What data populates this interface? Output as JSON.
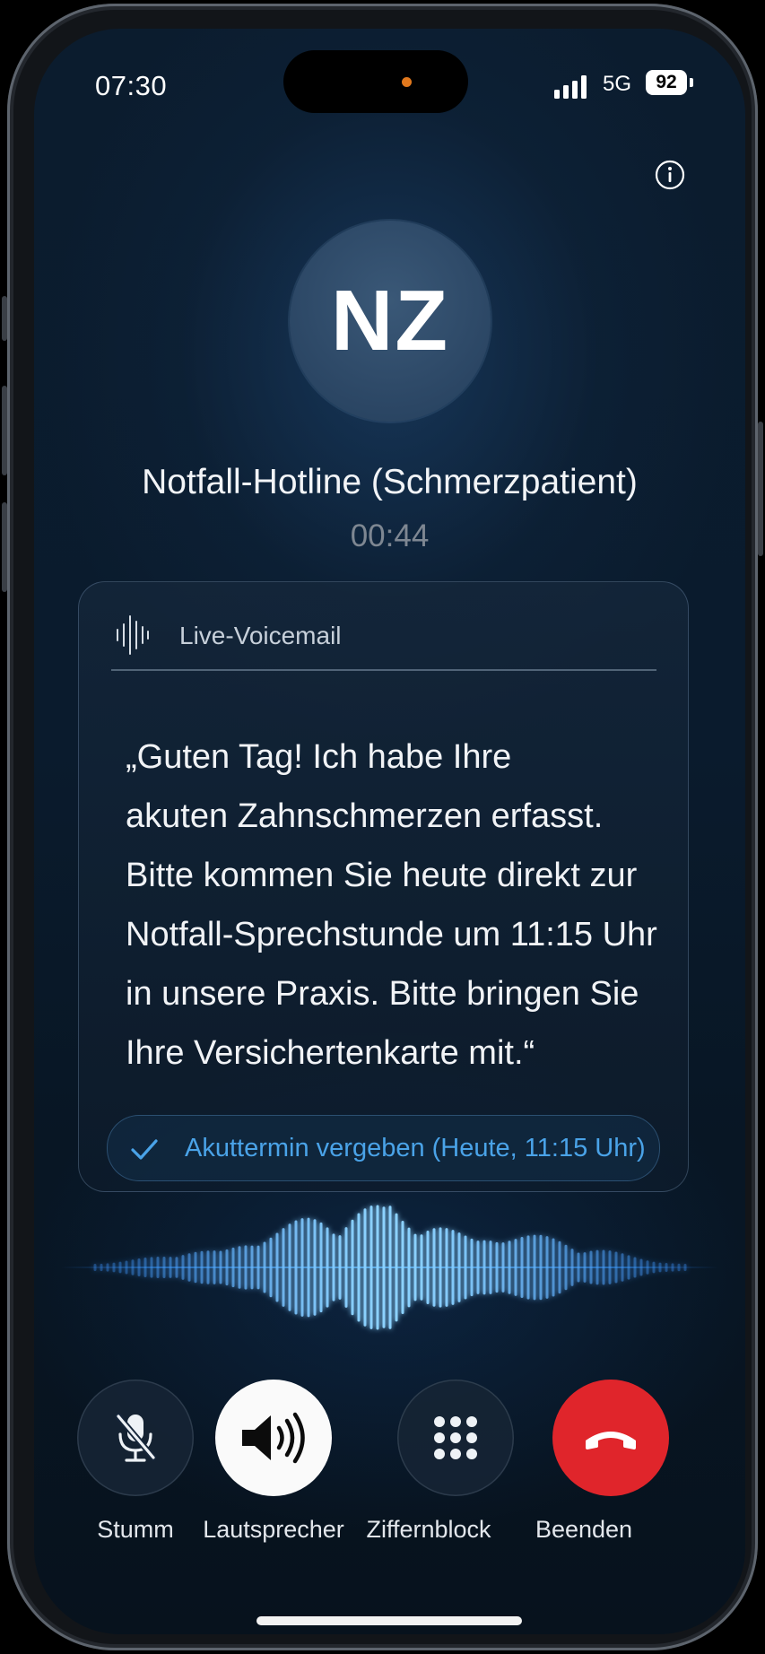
{
  "status_bar": {
    "time": "07:30",
    "network": "5G",
    "battery": "92",
    "signal_bars": 4
  },
  "caller": {
    "initials": "NZ",
    "name": "Notfall-Hotline (Schmerzpatient)",
    "duration": "00:44"
  },
  "voicemail": {
    "header_label": "Live-Voicemail",
    "transcript": "„Guten Tag! Ich habe Ihre\nakuten Zahnschmerzen erfasst.\nBitte kommen Sie heute direkt zur\nNotfall-Sprechstunde um 11:15 Uhr\nin unsere Praxis. Bitte bringen Sie\nIhre Versichertenkarte mit.“",
    "status_label": "Akuttermin vergeben (Heute, 11:15 Uhr)"
  },
  "controls": [
    {
      "label": "Stumm",
      "icon": "mic-off-icon"
    },
    {
      "label": "Lautsprecher",
      "icon": "speaker-icon"
    },
    {
      "label": "Ziffernblock",
      "icon": "keypad-icon"
    },
    {
      "label": "Beenden",
      "icon": "end-call-icon"
    }
  ],
  "colors": {
    "accent": "#4aa3e8",
    "end_call": "#e0252b",
    "background": "#0a1b2d"
  }
}
